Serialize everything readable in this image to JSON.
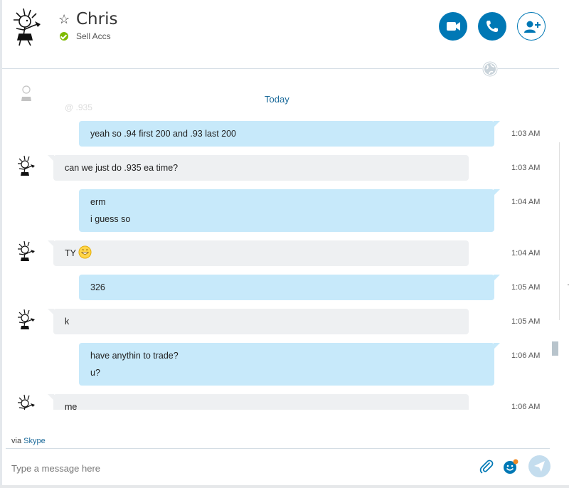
{
  "header": {
    "contact_name": "Chris",
    "mood_message": "Sell Accs",
    "status_color": "#7fba00",
    "icons": [
      "star-icon",
      "video-call-icon",
      "phone-icon",
      "add-contact-icon",
      "globe-icon"
    ],
    "accent_color": "#0078b5"
  },
  "chat": {
    "faded_previous": {
      "text": "@ .935"
    },
    "date_divider": "Today",
    "messages": [
      {
        "direction": "out",
        "lines": [
          "yeah so .94 first 200 and .93 last 200"
        ],
        "time": "1:03 AM"
      },
      {
        "direction": "in",
        "lines": [
          "can we just do .935 ea time?"
        ],
        "time": "1:03 AM"
      },
      {
        "direction": "out",
        "lines": [
          "erm",
          "i guess so"
        ],
        "time": "1:04 AM"
      },
      {
        "direction": "in",
        "lines": [
          "TY"
        ],
        "emoji": "grinning-emoji",
        "time": "1:04 AM"
      },
      {
        "direction": "out",
        "lines": [
          "326"
        ],
        "time": "1:05 AM"
      },
      {
        "direction": "in",
        "lines": [
          "k"
        ],
        "time": "1:05 AM"
      },
      {
        "direction": "out",
        "lines": [
          "have anythin to trade?",
          "u?"
        ],
        "time": "1:06 AM"
      },
      {
        "direction": "in",
        "lines": [
          "me"
        ],
        "time": "1:06 AM"
      }
    ],
    "outgoing_color": "#c7e9fa",
    "incoming_color": "#eef0f2"
  },
  "footer": {
    "via_prefix": "via",
    "via_link": "Skype",
    "composer_placeholder": "Type a message here",
    "icons": [
      "paperclip-icon",
      "emoticon-icon",
      "send-icon"
    ]
  }
}
